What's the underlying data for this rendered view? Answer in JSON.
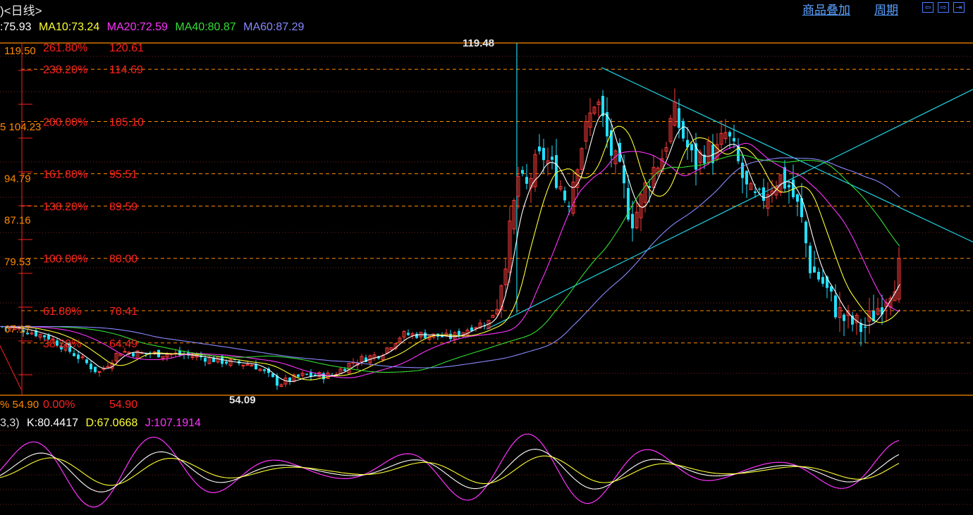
{
  "header": {
    "period_label": ")<日线>",
    "overlay_link": "商品叠加",
    "period_link": "周期",
    "nav_icons": [
      "prev-icon",
      "next-icon",
      "end-icon"
    ]
  },
  "ma_legend": [
    {
      "label": ":75.93",
      "color": "#ffffff"
    },
    {
      "label": "MA10:73.24",
      "color": "#ffff33"
    },
    {
      "label": "MA20:72.59",
      "color": "#ff33ff"
    },
    {
      "label": "MA40:80.87",
      "color": "#33dd33"
    },
    {
      "label": "MA60:87.29",
      "color": "#8888ff"
    }
  ],
  "kdj_legend": [
    {
      "label": "3,3)",
      "color": "#dddddd"
    },
    {
      "label": "K:80.4417",
      "color": "#ffffff"
    },
    {
      "label": "D:67.0668",
      "color": "#ffff33"
    },
    {
      "label": "J:107.1914",
      "color": "#ff33ff"
    }
  ],
  "axis_labels": [
    "119.50",
    "104.23",
    "94.79",
    "87.16",
    "79.53",
    "67.17",
    "54.90"
  ],
  "axis_label_prefixes": {
    "104.23": "5",
    "54.90": "%"
  },
  "fib_levels": [
    {
      "pct": "261.80%",
      "value": "120.61"
    },
    {
      "pct": "238.20%",
      "value": "114.69"
    },
    {
      "pct": "200.00%",
      "value": "105.10"
    },
    {
      "pct": "161.80%",
      "value": "95.51"
    },
    {
      "pct": "138.20%",
      "value": "89.59"
    },
    {
      "pct": "100.00%",
      "value": "80.00"
    },
    {
      "pct": "61.80%",
      "value": "70.41"
    },
    {
      "pct": "38.20%",
      "value": "64.49"
    },
    {
      "pct": "0.00%",
      "value": "54.90"
    }
  ],
  "annotations": {
    "high": "119.48",
    "low": "54.09"
  },
  "chart_data": {
    "type": "candlestick",
    "ylim": [
      54.9,
      119.5
    ],
    "fib_base": 54.9,
    "fib_top": 80.0,
    "high": 119.48,
    "low": 54.09,
    "price_path": [
      [
        0,
        67.5
      ],
      [
        30,
        67.0
      ],
      [
        70,
        65.5
      ],
      [
        110,
        62.0
      ],
      [
        140,
        59.0
      ],
      [
        170,
        63.0
      ],
      [
        200,
        62.5
      ],
      [
        240,
        62.5
      ],
      [
        280,
        62.0
      ],
      [
        320,
        61.0
      ],
      [
        360,
        60.5
      ],
      [
        395,
        57.0
      ],
      [
        430,
        58.5
      ],
      [
        470,
        58.5
      ],
      [
        500,
        61.0
      ],
      [
        540,
        62.5
      ],
      [
        570,
        66.0
      ],
      [
        600,
        66.0
      ],
      [
        640,
        65.5
      ],
      [
        670,
        67.5
      ],
      [
        695,
        68.5
      ],
      [
        705,
        72.0
      ],
      [
        715,
        79.0
      ],
      [
        725,
        86.0
      ],
      [
        735,
        95.0
      ],
      [
        745,
        92.0
      ],
      [
        755,
        96.0
      ],
      [
        770,
        99.0
      ],
      [
        790,
        95.0
      ],
      [
        805,
        90.0
      ],
      [
        820,
        99.0
      ],
      [
        835,
        105.0
      ],
      [
        845,
        110.0
      ],
      [
        855,
        105.0
      ],
      [
        865,
        100.0
      ],
      [
        880,
        95.0
      ],
      [
        895,
        87.0
      ],
      [
        905,
        89.0
      ],
      [
        915,
        93.0
      ],
      [
        925,
        96.0
      ],
      [
        940,
        99.0
      ],
      [
        955,
        107.0
      ],
      [
        970,
        102.0
      ],
      [
        985,
        97.0
      ],
      [
        1000,
        100.0
      ],
      [
        1015,
        99.0
      ],
      [
        1030,
        103.0
      ],
      [
        1045,
        98.0
      ],
      [
        1060,
        92.0
      ],
      [
        1075,
        90.0
      ],
      [
        1090,
        93.0
      ],
      [
        1105,
        95.0
      ],
      [
        1120,
        93.0
      ],
      [
        1135,
        88.0
      ],
      [
        1150,
        78.0
      ],
      [
        1165,
        76.0
      ],
      [
        1180,
        72.0
      ],
      [
        1195,
        69.0
      ],
      [
        1210,
        68.0
      ],
      [
        1225,
        67.0
      ],
      [
        1240,
        70.0
      ],
      [
        1255,
        73.0
      ],
      [
        1268,
        76.0
      ],
      [
        1278,
        79.0
      ]
    ],
    "series": [
      {
        "name": "MA10",
        "color": "#ffff33",
        "lag": 2
      },
      {
        "name": "MA20",
        "color": "#ff33ff",
        "lag": 4
      },
      {
        "name": "MA40",
        "color": "#33dd33",
        "lag": 8
      },
      {
        "name": "MA60",
        "color": "#8888ff",
        "lag": 12
      }
    ],
    "kdj": {
      "ylim": [
        -10,
        110
      ],
      "K": 80.4417,
      "D": 67.0668,
      "J": 107.1914
    }
  },
  "colors": {
    "up": "#ff3b3b",
    "down": "#22e0ff",
    "trend": "#1fd3e3",
    "fib_line": "#ff8a00",
    "fib_text": "#ff2020",
    "grid": "#7a2020"
  }
}
